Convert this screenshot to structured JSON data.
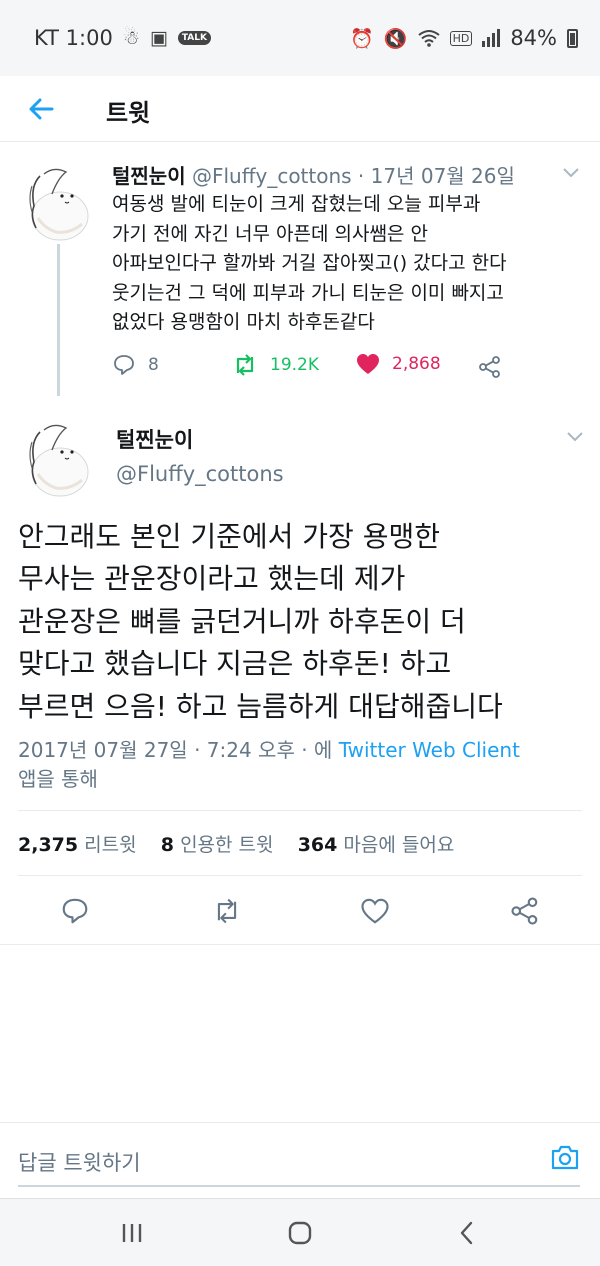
{
  "status_bar": {
    "carrier_time": "KT 1:00",
    "talk_badge": "TALK",
    "hd_badge": "HD",
    "battery": "84%"
  },
  "header": {
    "title": "트윗",
    "back_icon": "arrow-left-icon"
  },
  "context_tweet": {
    "name": "털찐눈이",
    "handle_date": "@Fluffy_cottons · 17년 07월 26일",
    "text_lines": [
      "여동생 발에 티눈이 크게 잡혔는데 오늘 피부과",
      "가기 전에 자긴 너무 아픈데 의사쌤은 안",
      "아파보인다구 할까봐 거길 잡아찢고() 갔다고 한다",
      "웃기는건 그 덕에 피부과 가니 티눈은 이미 빠지고",
      "없었다 용맹함이 마치 하후돈같다"
    ],
    "replies": "8",
    "retweets": "19.2K",
    "likes": "2,868",
    "liked": true
  },
  "main_tweet": {
    "name": "털찐눈이",
    "handle": "@Fluffy_cottons",
    "text_lines": [
      "안그래도 본인 기준에서 가장 용맹한",
      "무사는 관운장이라고 했는데 제가",
      "관운장은 뼈를 긁던거니까 하후돈이 더",
      "맞다고 했습니다 지금은 하후돈! 하고",
      "부르면 으음! 하고 늠름하게 대답해줍니다"
    ],
    "timestamp": "2017년 07월 27일 · 7:24 오후 · 에",
    "client": "Twitter Web Client",
    "via": "앱을 통해",
    "stats": {
      "retweets_count": "2,375",
      "retweets_label": "리트윗",
      "quotes_count": "8",
      "quotes_label": "인용한 트윗",
      "likes_count": "364",
      "likes_label": "마음에 들어요"
    }
  },
  "reply_bar": {
    "placeholder": "답글 트윗하기"
  },
  "colors": {
    "accent": "#1da1f2",
    "retweet_green": "#17bf63",
    "like_pink": "#e0245e",
    "secondary_text": "#657786"
  }
}
